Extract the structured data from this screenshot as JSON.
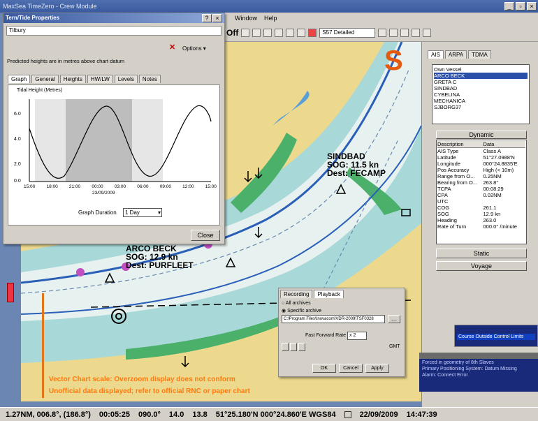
{
  "app": {
    "title": "MaxSea TimeZero - Crew Module",
    "menu": [
      "Window",
      "Help"
    ],
    "toolbar": {
      "off_label": "Off",
      "zoom_select": "S57 Detailed"
    }
  },
  "tide_window": {
    "title": "Tern/Tide Properties",
    "station": "Tilbury",
    "options_label": "Options",
    "note": "Predicted heights are in metres above chart datum",
    "tabs": [
      "Graph",
      "General",
      "Heights",
      "HW/LW",
      "Levels",
      "Notes"
    ],
    "graph": {
      "ylabel": "Tidal Height (Metres)",
      "yticks": [
        "6.0",
        "4.0",
        "2.0",
        "0.0"
      ],
      "xticks": [
        "15:00",
        "18:00",
        "21:00",
        "00:00",
        "03:00",
        "06:00",
        "09:00",
        "12:00",
        "15:00"
      ],
      "date_label": "23/09/2009",
      "duration_label": "Graph Duration",
      "duration_value": "1 Day"
    },
    "close_label": "Close"
  },
  "chart_labels": {
    "sindbad": [
      "SINDBAD",
      "SOG: 11.5 kn",
      "Dest: FECAMP"
    ],
    "arco": [
      "ARCO BECK",
      "SOG: 12.9 kn",
      "Dest: PURFLEET"
    ],
    "warning1": "Vector Chart scale: Overzoom display does not conform",
    "warning2": "Unofficial data displayed; refer to official RNC or paper chart"
  },
  "right_panel": {
    "tabs": [
      "AIS",
      "ARPA",
      "TDMA"
    ],
    "vessels": [
      "Own Vessel",
      "ARCO BECK",
      "GRETA C",
      "SINDBAD",
      "CYBELINA",
      "MECHANICA",
      "SJBORG37"
    ],
    "selected_vessel": "ARCO BECK",
    "dynamic_header": "Dynamic",
    "columns": [
      "Description",
      "Data"
    ],
    "rows": [
      [
        "AIS Type",
        "Class A"
      ],
      [
        "Latitude",
        "51°27.0988'N"
      ],
      [
        "Longitude",
        "000°24.8835'E"
      ],
      [
        "Pos Accuracy",
        "High (< 10m)"
      ],
      [
        "Range from O...",
        "0.25NM"
      ],
      [
        "Bearing from O...",
        "263.8°"
      ],
      [
        "TCPA",
        "00:08:29"
      ],
      [
        "CPA",
        "0.02NM"
      ],
      [
        "UTC",
        ""
      ],
      [
        "COG",
        "261.1"
      ],
      [
        "SOG",
        "12.9 kn"
      ],
      [
        "Heading",
        "263.0"
      ],
      [
        "Rate of Turn",
        "000.0° /minute"
      ]
    ],
    "static_label": "Static",
    "voyage_label": "Voyage"
  },
  "playback": {
    "tabs": [
      "Recording",
      "Playback"
    ],
    "all_archives": "All archives",
    "specific_archive": "Specific archive",
    "path": "C:\\Program Files\\Inovacom\\VDR-2009\\TSF0328",
    "fast_forward_label": "Fast Forward Rate",
    "fast_forward_value": "x 2",
    "time_label": "GMT",
    "buttons": [
      "OK",
      "Cancel",
      "Apply"
    ]
  },
  "alarm": {
    "lines": [
      "Forced in geometry of 8th Slaves",
      "Primary Positioning System: Datum Missing",
      "Alarm: Connect Error"
    ],
    "alert_text": "Course Outside Control Limits"
  },
  "status_bar": {
    "range": "1.27NM, 006.8°, (186.8°)",
    "timer": "00:05:25",
    "heading": "090.0°",
    "speed1": "14.0",
    "speed2": "13.8",
    "position": "51°25.180'N 000°24.860'E WGS84",
    "date": "22/09/2009",
    "time": "14:47:39"
  },
  "colors": {
    "land": "#ecd98d",
    "shallow": "#a9d8d8",
    "deep": "#e7f1f0",
    "green": "#4bb06a",
    "alert_orange": "#ff7a10"
  }
}
